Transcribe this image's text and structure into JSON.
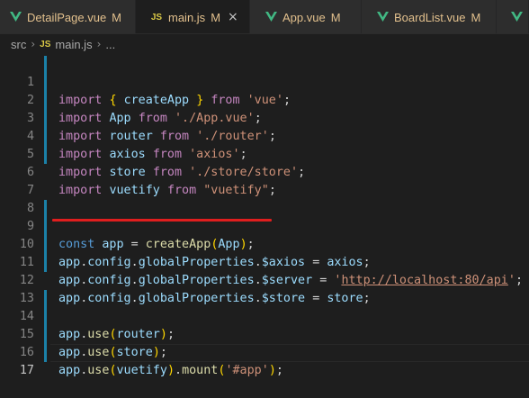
{
  "tabs": [
    {
      "name": "DetailPage.vue",
      "icon": "vue-icon",
      "modified": "M",
      "active": false
    },
    {
      "name": "main.js",
      "icon": "js-icon",
      "modified": "M",
      "active": true
    },
    {
      "name": "App.vue",
      "icon": "vue-icon",
      "modified": "M",
      "active": false
    },
    {
      "name": "BoardList.vue",
      "icon": "vue-icon",
      "modified": "M",
      "active": false
    }
  ],
  "close_glyph": "×",
  "breadcrumb": {
    "folder": "src",
    "file_icon": "JS",
    "file": "main.js",
    "more": "..."
  },
  "colors": {
    "vue": "#41b883",
    "js": "#d9c845",
    "underline": "#e01e1e",
    "modified": "#e2c08d"
  },
  "lines": [
    {
      "n": "1",
      "text": "import { createApp } from 'vue';"
    },
    {
      "n": "2",
      "text": "import App from './App.vue';"
    },
    {
      "n": "3",
      "text": "import router from './router';"
    },
    {
      "n": "4",
      "text": "import axios from 'axios';"
    },
    {
      "n": "5",
      "text": "import store from './store/store';"
    },
    {
      "n": "6",
      "text": "import vuetify from \"vuetify\";"
    },
    {
      "n": "7",
      "text": ""
    },
    {
      "n": "8",
      "text": ""
    },
    {
      "n": "9",
      "text": "const app = createApp(App);"
    },
    {
      "n": "10",
      "text": "app.config.globalProperties.$axios = axios;"
    },
    {
      "n": "11",
      "text": "app.config.globalProperties.$server = 'http://localhost:80/api';"
    },
    {
      "n": "12",
      "text": "app.config.globalProperties.$store = store;"
    },
    {
      "n": "13",
      "text": ""
    },
    {
      "n": "14",
      "text": "app.use(router);"
    },
    {
      "n": "15",
      "text": "app.use(store);"
    },
    {
      "n": "16",
      "text": "app.use(vuetify).mount('#app');"
    },
    {
      "n": "17",
      "text": ""
    }
  ]
}
